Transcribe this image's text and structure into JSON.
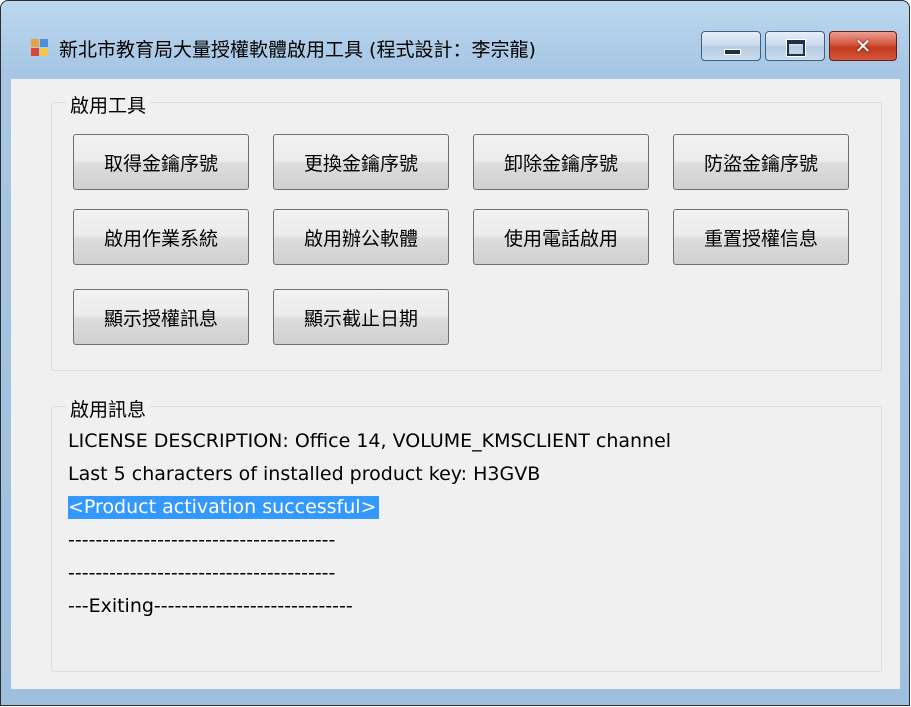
{
  "window": {
    "title": "新北市教育局大量授權軟體啟用工具 (程式設計：李宗龍)",
    "icon": "app-window-icon",
    "caption": {
      "minimize_icon": "minimize-icon",
      "maximize_icon": "maximize-icon",
      "close_label": "✕"
    }
  },
  "tools_group": {
    "title": "啟用工具",
    "buttons": [
      "取得金鑰序號",
      "更換金鑰序號",
      "卸除金鑰序號",
      "防盜金鑰序號",
      "啟用作業系統",
      "啟用辦公軟體",
      "使用電話啟用",
      "重置授權信息",
      "顯示授權訊息",
      "顯示截止日期"
    ]
  },
  "info_group": {
    "title": "啟用訊息",
    "lines": [
      "LICENSE DESCRIPTION: Office 14, VOLUME_KMSCLIENT channel",
      "Last 5 characters of installed product key: H3GVB",
      "<Product activation successful>",
      "---------------------------------------",
      "---------------------------------------",
      "---Exiting-----------------------------"
    ],
    "highlighted_line": 2
  },
  "colors": {
    "selection": "#3399ff",
    "client_background": "#f0f0f0",
    "frame": "#a6c6e4"
  }
}
